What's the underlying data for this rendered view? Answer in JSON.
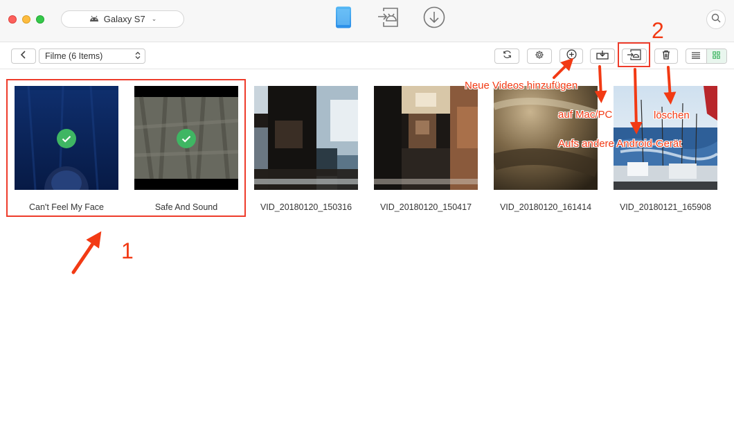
{
  "window": {
    "device_name": "Galaxy S7"
  },
  "top_nav": [
    {
      "name": "phone-icon",
      "active": true
    },
    {
      "name": "android-transfer-icon",
      "active": false
    },
    {
      "name": "download-icon",
      "active": false
    }
  ],
  "toolbar": {
    "folder_label": "Filme (6 Items)",
    "active_view": "grid",
    "accent_color": "#3fb663"
  },
  "videos": [
    {
      "title": "Can't Feel My Face",
      "selected": true
    },
    {
      "title": "Safe And Sound",
      "selected": true
    },
    {
      "title": "VID_20180120_150316",
      "selected": false
    },
    {
      "title": "VID_20180120_150417",
      "selected": false
    },
    {
      "title": "VID_20180120_161414",
      "selected": false
    },
    {
      "title": "VID_20180121_165908",
      "selected": false
    }
  ],
  "annotations": {
    "step1": "1",
    "step2": "2",
    "add_videos": "Neue Videos hinzufügen",
    "to_mac_pc": "auf Mac/PC",
    "to_android": "Aufs andere Android-Gerät",
    "delete": "löschen",
    "color": "#f23a14"
  }
}
